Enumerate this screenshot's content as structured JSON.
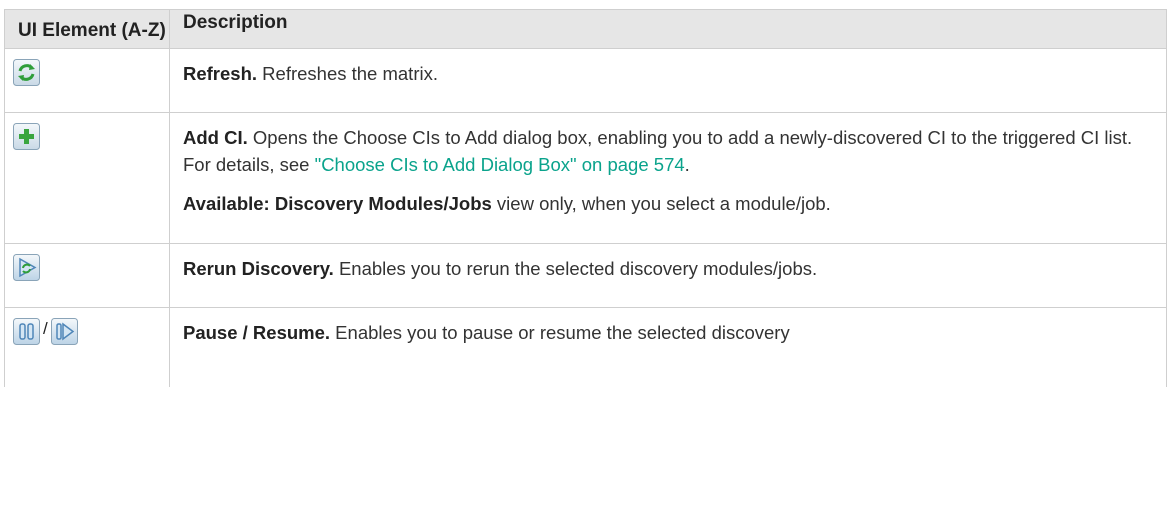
{
  "table": {
    "header": {
      "col1": "UI Element (A-Z)",
      "col2": "Description"
    },
    "rows": [
      {
        "icons": [
          "refresh-icon"
        ],
        "term": "Refresh.",
        "text": " Refreshes the matrix."
      },
      {
        "icons": [
          "add-ci-icon"
        ],
        "term": "Add CI.",
        "text": " Opens the Choose CIs to Add dialog box, enabling you to add a newly-discovered CI to the triggered CI list. For details, see ",
        "link": "\"Choose CIs to Add Dialog Box\" on page 574",
        "after_link": ".",
        "note_term": "Available: Discovery Modules/Jobs",
        "note_text": " view only, when you select a module/job."
      },
      {
        "icons": [
          "rerun-discovery-icon"
        ],
        "term": "Rerun Discovery.",
        "text": " Enables you to rerun the selected discovery modules/jobs."
      },
      {
        "icons": [
          "pause-icon",
          "resume-icon"
        ],
        "separator": "/",
        "term": "Pause / Resume.",
        "text": " Enables you to pause or resume the selected discovery"
      }
    ]
  }
}
